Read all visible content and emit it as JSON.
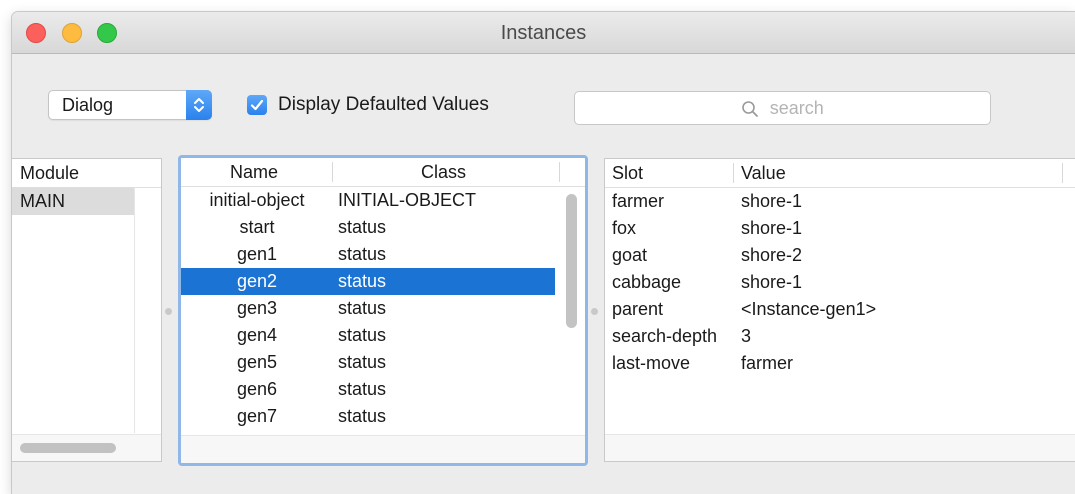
{
  "window": {
    "title": "Instances"
  },
  "toolbar": {
    "popup_value": "Dialog",
    "checkbox_label": "Display Defaulted Values",
    "checkbox_checked": true,
    "search_placeholder": "search"
  },
  "modules": {
    "header": "Module",
    "items": [
      "MAIN"
    ],
    "selected": "MAIN"
  },
  "instances": {
    "headers": {
      "name": "Name",
      "class": "Class"
    },
    "rows": [
      {
        "name": "initial-object",
        "class": "INITIAL-OBJECT"
      },
      {
        "name": "start",
        "class": "status"
      },
      {
        "name": "gen1",
        "class": "status"
      },
      {
        "name": "gen2",
        "class": "status"
      },
      {
        "name": "gen3",
        "class": "status"
      },
      {
        "name": "gen4",
        "class": "status"
      },
      {
        "name": "gen5",
        "class": "status"
      },
      {
        "name": "gen6",
        "class": "status"
      },
      {
        "name": "gen7",
        "class": "status"
      }
    ],
    "selected_index": 3
  },
  "slots": {
    "headers": {
      "slot": "Slot",
      "value": "Value"
    },
    "rows": [
      {
        "slot": "farmer",
        "value": "shore-1"
      },
      {
        "slot": "fox",
        "value": "shore-1"
      },
      {
        "slot": "goat",
        "value": "shore-2"
      },
      {
        "slot": "cabbage",
        "value": "shore-1"
      },
      {
        "slot": "parent",
        "value": "<Instance-gen1>"
      },
      {
        "slot": "search-depth",
        "value": "3"
      },
      {
        "slot": "last-move",
        "value": "farmer"
      }
    ]
  },
  "colors": {
    "accent": "#2a82ee",
    "selection": "#1b73d3",
    "focus_ring": "#8fb7e8"
  },
  "icons": {
    "close": "close-icon",
    "minimize": "minimize-icon",
    "zoom": "zoom-icon",
    "popup": "chevron-up-down-icon",
    "checkbox": "checkmark-icon",
    "search": "search-icon"
  }
}
